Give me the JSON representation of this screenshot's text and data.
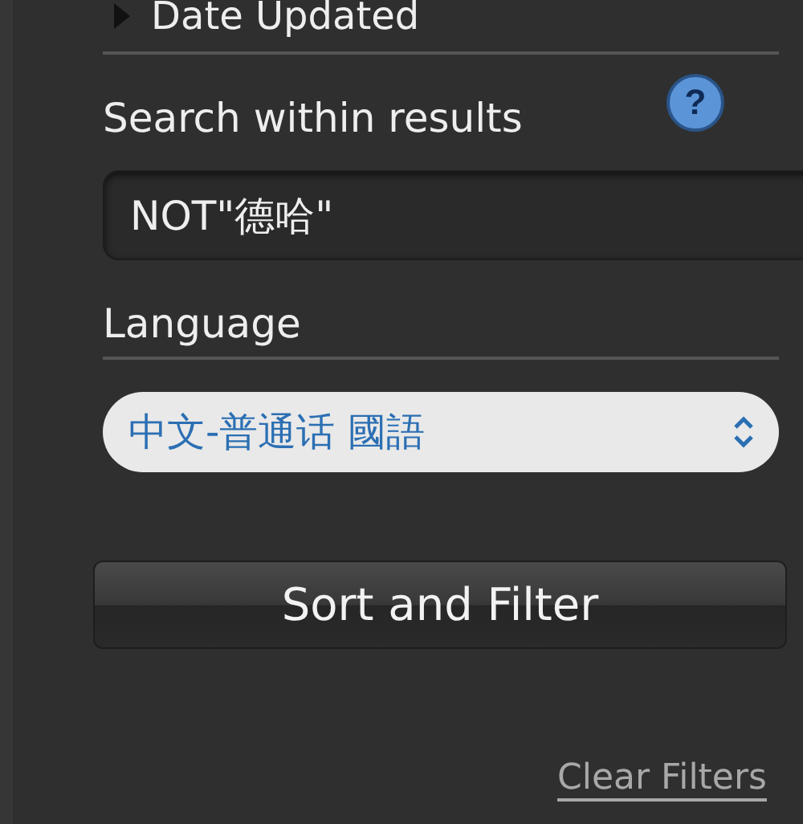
{
  "sort_option": {
    "label": "Date Updated",
    "expanded": false
  },
  "search": {
    "label": "Search within results",
    "help": "?",
    "value": "NOT\"德哈\""
  },
  "language": {
    "label": "Language",
    "value": "中文-普通话 國語"
  },
  "submit": {
    "label": "Sort and Filter"
  },
  "clear_link": {
    "label": "Clear Filters"
  }
}
